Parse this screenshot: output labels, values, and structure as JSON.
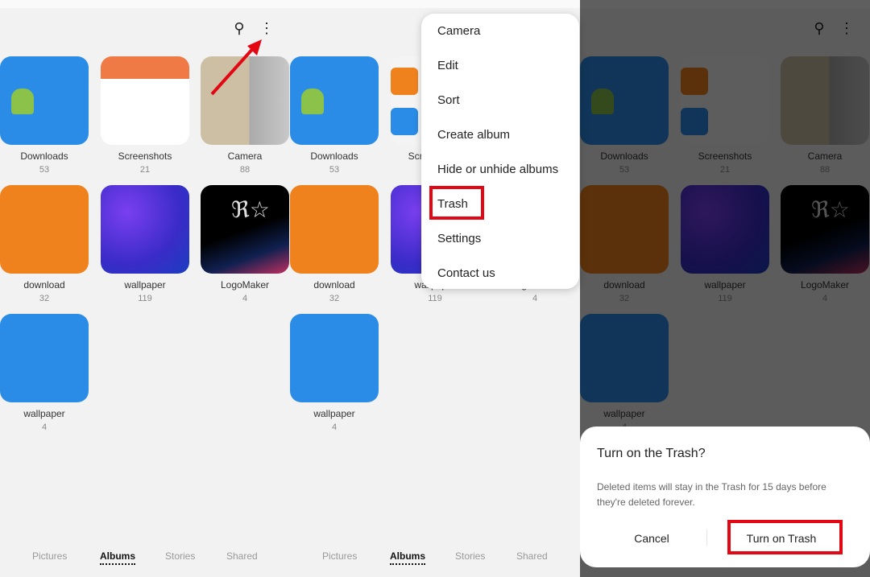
{
  "colors": {
    "accent_red": "#e30613",
    "tile_blue": "#2a8ce6",
    "tile_orange": "#f0821e"
  },
  "toolbar": {
    "search_icon": "search-icon",
    "more_icon": "more-vertical-icon"
  },
  "albums": [
    {
      "name": "Downloads",
      "count": "53",
      "thumb": "android"
    },
    {
      "name": "Screenshots",
      "count": "21",
      "thumb": "screenshot"
    },
    {
      "name": "Camera",
      "count": "88",
      "thumb": "photo"
    },
    {
      "name": "download",
      "count": "32",
      "thumb": "orange"
    },
    {
      "name": "wallpaper",
      "count": "119",
      "thumb": "purple"
    },
    {
      "name": "LogoMaker",
      "count": "4",
      "thumb": "logo"
    },
    {
      "name": "wallpaper",
      "count": "4",
      "thumb": "blue"
    }
  ],
  "bottom_nav": [
    "Pictures",
    "Albums",
    "Stories",
    "Shared"
  ],
  "active_tab": "Albums",
  "menu": {
    "items": [
      "Camera",
      "Edit",
      "Sort",
      "Create album",
      "Hide or unhide albums",
      "Trash",
      "Settings",
      "Contact us"
    ]
  },
  "dialog": {
    "title": "Turn on the Trash?",
    "message": "Deleted items will stay in the Trash for 15 days before they're deleted forever.",
    "cancel": "Cancel",
    "confirm": "Turn on Trash"
  }
}
